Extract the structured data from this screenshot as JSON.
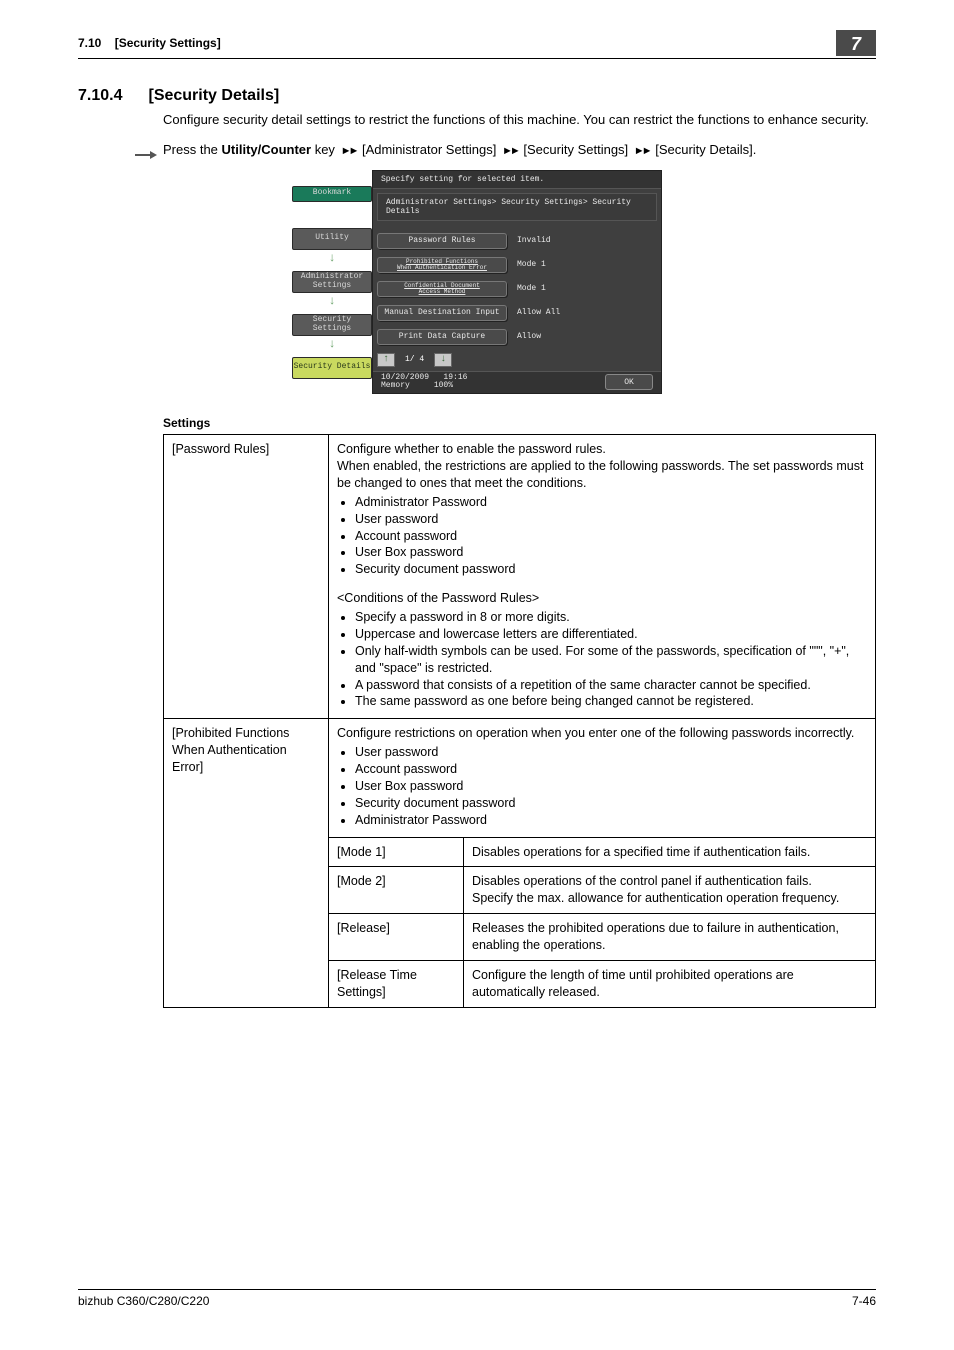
{
  "header": {
    "breadcrumb_num": "7.10",
    "breadcrumb_title": "[Security Settings]",
    "chapter": "7"
  },
  "section": {
    "number": "7.10.4",
    "title": "[Security Details]"
  },
  "intro": "Configure security detail settings to restrict the functions of this machine. You can restrict the functions to enhance security.",
  "nav": {
    "press_the": "Press the ",
    "key_bold": "Utility/Counter",
    "key_after": " key ",
    "steps": [
      "[Administrator Settings]",
      "[Security Settings]",
      "[Security Details]."
    ]
  },
  "panel": {
    "title": "Specify setting for selected item.",
    "breadcrumb": "Administrator Settings> Security Settings> Security Details",
    "side": {
      "bookmark": "Bookmark",
      "items": [
        "Utility",
        "Administrator Settings",
        "Security Settings"
      ],
      "active": "Security Details"
    },
    "rows": [
      {
        "label": "Password Rules",
        "value": "Invalid",
        "class": ""
      },
      {
        "label_top": "Prohibited Functions",
        "label_bot": "When Authentication Error",
        "value": "Mode 1",
        "class": "multi"
      },
      {
        "label_top": "Confidential Document",
        "label_bot": "Access Method",
        "value": "Mode 1",
        "class": "multi"
      },
      {
        "label": "Manual Destination Input",
        "value": "Allow All",
        "class": ""
      },
      {
        "label": "Print Data Capture",
        "value": "Allow",
        "class": ""
      }
    ],
    "pager": "1/ 4",
    "foot": {
      "date": "10/20/2009",
      "time": "19:16",
      "mem_lbl": "Memory",
      "mem_val": "100%",
      "ok": "OK"
    }
  },
  "table": {
    "heading": "Settings",
    "r1_label": "[Password Rules]",
    "r1_intro": "Configure whether to enable the password rules.\nWhen enabled, the restrictions are applied to the following passwords. The set passwords must be changed to ones that meet the conditions.",
    "r1_list": [
      "Administrator Password",
      "User password",
      "Account password",
      "User Box password",
      "Security document password"
    ],
    "r1_sub": "<Conditions of the Password Rules>",
    "r1_cond": [
      "Specify a password in 8 or more digits.",
      "Uppercase and lowercase letters are differentiated.",
      "Only half-width symbols can be used. For some of the passwords, specification of \"\"\", \"+\", and \"space\" is restricted.",
      "A password that consists of a repetition of the same character cannot be specified.",
      "The same password as one before being changed cannot be registered."
    ],
    "r2_label": "[Prohibited Functions When Authentication Error]",
    "r2_intro": "Configure restrictions on operation when you enter one of the following passwords incorrectly.",
    "r2_list": [
      "User password",
      "Account password",
      "User Box password",
      "Security document password",
      "Administrator Password"
    ],
    "modes": [
      {
        "k": "[Mode 1]",
        "v": "Disables operations for a specified time if authentication fails."
      },
      {
        "k": "[Mode 2]",
        "v": "Disables operations of the control panel if authentication fails.\nSpecify the max. allowance for authentication operation frequency."
      },
      {
        "k": "[Release]",
        "v": "Releases the prohibited operations due to failure in authentication, enabling the operations."
      },
      {
        "k": "[Release Time Settings]",
        "v": "Configure the length of time until prohibited operations are automatically released."
      }
    ]
  },
  "footer": {
    "model": "bizhub C360/C280/C220",
    "page": "7-46"
  }
}
